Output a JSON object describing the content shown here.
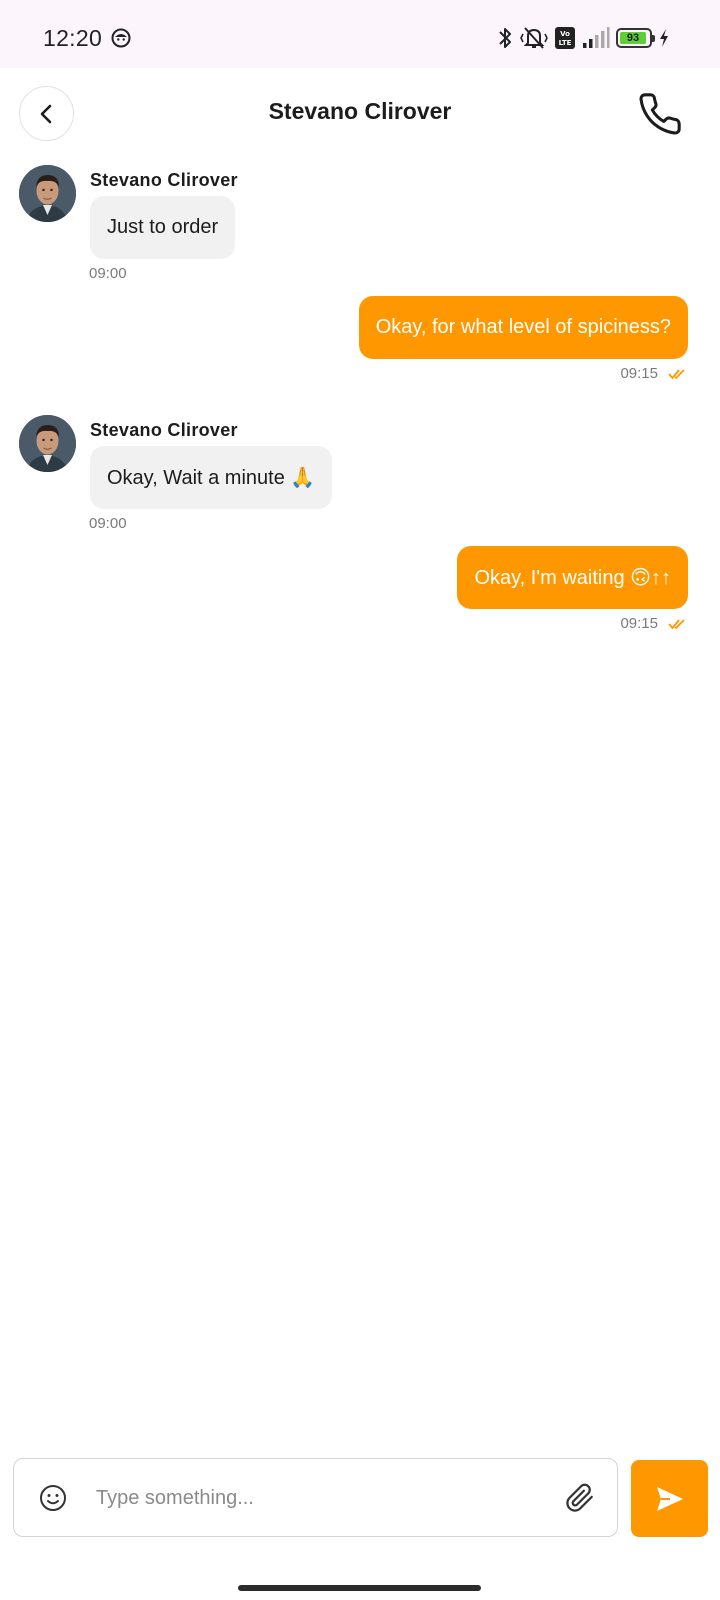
{
  "status_bar": {
    "time": "12:20",
    "battery_level": "93",
    "icons": [
      "smiley-notification-icon",
      "bluetooth-icon",
      "vibrate-off-icon",
      "volte-icon",
      "signal-icon",
      "battery-icon",
      "charging-icon"
    ]
  },
  "header": {
    "title": "Stevano Clirover",
    "back_icon": "chevron-left-icon",
    "call_icon": "phone-icon"
  },
  "messages": [
    {
      "direction": "incoming",
      "sender": "Stevano Clirover",
      "text": "Just to order",
      "time": "09:00"
    },
    {
      "direction": "outgoing",
      "text": "Okay, for what level of spiciness?",
      "time": "09:15",
      "status": "read"
    },
    {
      "direction": "incoming",
      "sender": "Stevano Clirover",
      "text": "Okay, Wait a minute 🙏",
      "time": "09:00"
    },
    {
      "direction": "outgoing",
      "text": "Okay, I'm waiting 🙃↑↑",
      "time": "09:15",
      "status": "read"
    }
  ],
  "composer": {
    "placeholder": "Type something...",
    "value": "",
    "emoji_icon": "emoji-icon",
    "attach_icon": "paperclip-icon",
    "send_icon": "send-icon"
  },
  "colors": {
    "accent": "#FF9800",
    "incoming_bubble": "#F1F1F1",
    "status_bar_bg": "#FCF5FC",
    "read_check": "#FF9800"
  }
}
